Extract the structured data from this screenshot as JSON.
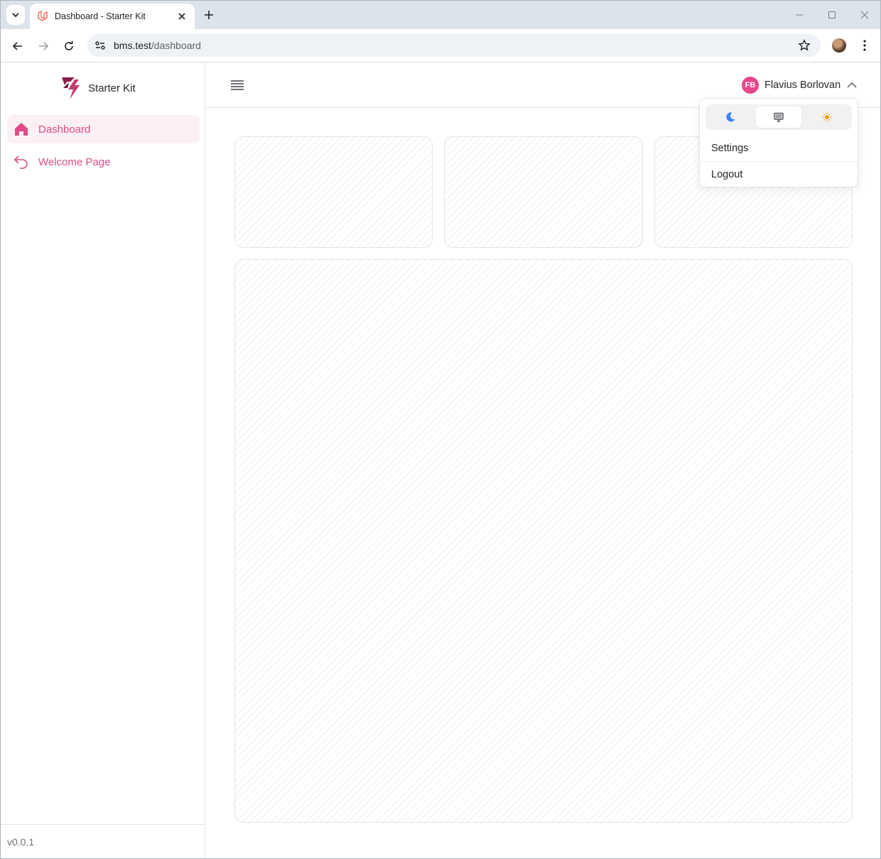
{
  "browser": {
    "tab_title": "Dashboard - Starter Kit",
    "url_host": "bms.test",
    "url_path": "/dashboard"
  },
  "sidebar": {
    "brand_name": "Starter Kit",
    "items": [
      {
        "label": "Dashboard",
        "icon": "home-icon",
        "active": true
      },
      {
        "label": "Welcome Page",
        "icon": "undo-arrow-icon",
        "active": false
      }
    ],
    "version": "v0.0.1"
  },
  "header": {
    "user_initials": "FB",
    "user_name": "Flavius Borlovan"
  },
  "user_dropdown": {
    "theme_options": [
      "moon-icon",
      "monitor-icon",
      "sun-icon"
    ],
    "selected_theme": "monitor-icon",
    "items": [
      {
        "label": "Settings"
      },
      {
        "label": "Logout"
      }
    ]
  },
  "colors": {
    "accent": "#e04a87",
    "avatar_bg": "#e8468d",
    "moon": "#3b82f6",
    "sun": "#f59e0b"
  }
}
